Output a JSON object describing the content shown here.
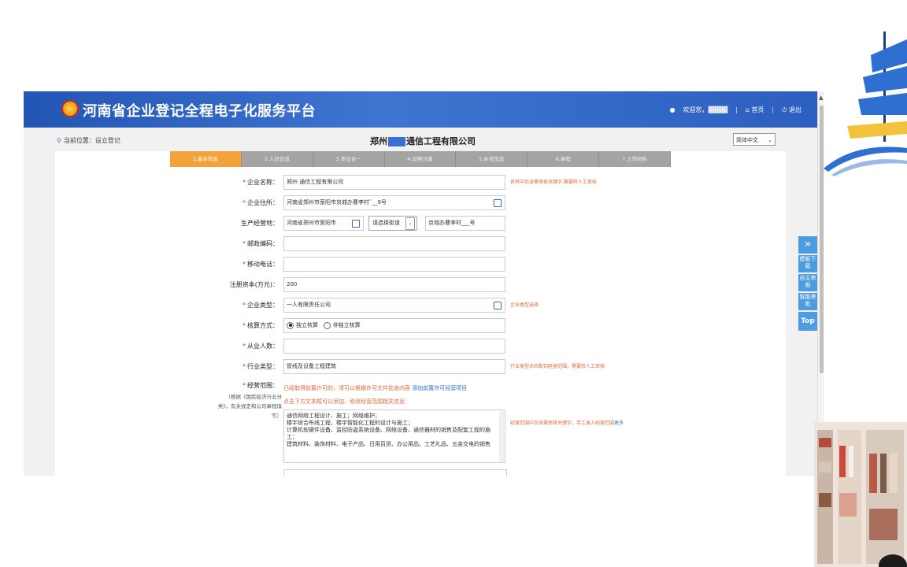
{
  "header": {
    "title": "河南省企业登记全程电子化服务平台",
    "welcome": "欢迎您，",
    "username": "▓▓▓▓",
    "home": "首页",
    "logout": "退出"
  },
  "breadcrumb": {
    "label": "当前位置：设立登记"
  },
  "company_title": {
    "prefix": "郑州",
    "suffix": "通信工程有限公司"
  },
  "language": {
    "selected": "简体中文"
  },
  "steps": [
    {
      "label": "1.基本信息",
      "active": true
    },
    {
      "label": "2.人员信息"
    },
    {
      "label": "3.多证合一"
    },
    {
      "label": "4.证照分离"
    },
    {
      "label": "5.补充信息"
    },
    {
      "label": "6.章程"
    },
    {
      "label": "7.上传材料"
    }
  ],
  "form": {
    "name": {
      "label": "企业名称：",
      "value": "郑州      通信工程有限公司",
      "hint": "名称中包含需审核关键字,需要转人工审核"
    },
    "address": {
      "label": "企业住所：",
      "value": "河南省郑州市荥阳市京城办曹李村`__9号"
    },
    "biz_address": {
      "label": "生产经营地：",
      "value1": "河南省郑州市荥阳市",
      "select": "请选择街道",
      "value3": "京城办曹李村___号"
    },
    "postcode": {
      "label": "邮政编码：",
      "value": ""
    },
    "mobile": {
      "label": "移动电话：",
      "value": ""
    },
    "capital": {
      "label": "注册资本(万元)：",
      "value": "200"
    },
    "type": {
      "label": "企业类型：",
      "value": "一人有限责任公司",
      "hint": "企业类型选择"
    },
    "accounting": {
      "label": "核算方式：",
      "opt1": "独立核算",
      "opt2": "非独立核算"
    },
    "employees": {
      "label": "从业人数：",
      "value": ""
    },
    "industry": {
      "label": "行业类型：",
      "value": "管线及设备工程建筑",
      "hint": "行业类型未匹配到经营范围，需要转人工审核"
    },
    "scope": {
      "label": "经营范围：",
      "note": "（根据《国民经济行业分类》，有关规定和公司章程填写）",
      "line1": "已经取得前置许可的，须可以根据许可文件批准内容",
      "link1": "添加前置许可经营项目",
      "line2": "点击下方文本框可以添加、修改经营范围相关信息：",
      "text": "通信网络工程设计、施工；网络维护；\n楼宇综合布线工程、楼宇智能化工程的设计与施工；\n计算机软硬件设备、监控防盗系统设备、网络设备、通信器材的销售及配套工程的施工；\n建筑材料、装饰材料、电子产品、日用百货、办公用品、工艺礼品、五金交电的销售",
      "hint": "经营范围中包含需审核关键字，手工录入经营范围",
      "hint_link": "更多"
    }
  },
  "side_tools": {
    "expand": "»",
    "template": "模板下载",
    "self_check": "自主审报",
    "smart_check": "智能审批",
    "top": "Top"
  }
}
